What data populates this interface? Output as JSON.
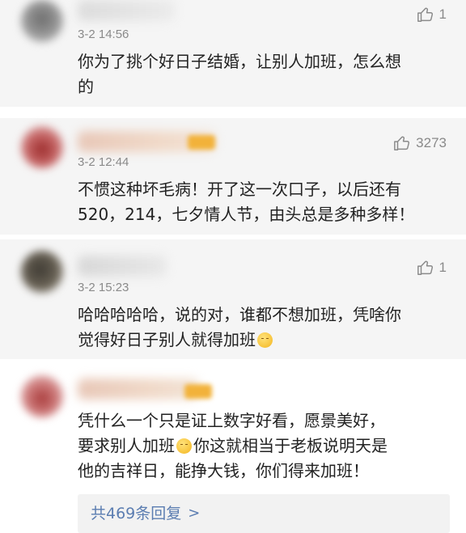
{
  "comments": [
    {
      "time": "3-2 14:56",
      "likes": "1",
      "lines": [
        "你为了挑个好日子结婚，让别人加班，怎么想",
        "的"
      ]
    },
    {
      "time": "3-2 12:44",
      "likes": "3273",
      "lines": [
        "不惯这种坏毛病！开了这一次口子，以后还有",
        "520，214，七夕情人节，由头总是多种多样！"
      ]
    },
    {
      "time": "3-2 15:23",
      "likes": "1",
      "lines": [
        "哈哈哈哈哈，说的对，谁都不想加班，凭啥你",
        "觉得好日子别人就得加班"
      ]
    },
    {
      "lines": [
        "凭什么一个只是证上数字好看，愿景美好，",
        "要求别人加班",
        "你这就相当于老板说明天是",
        "他的吉祥日，能挣大钱，你们得来加班！"
      ],
      "replies_label": "共469条回复",
      "replies_chevron": ">"
    }
  ],
  "icons": {
    "like": "thumbs-up-icon",
    "emoji": "smirk-emoji-icon"
  },
  "colors": {
    "text": "#222222",
    "meta": "#8a8a8a",
    "link": "#5b7db1",
    "panel": "#f5f5f5"
  }
}
